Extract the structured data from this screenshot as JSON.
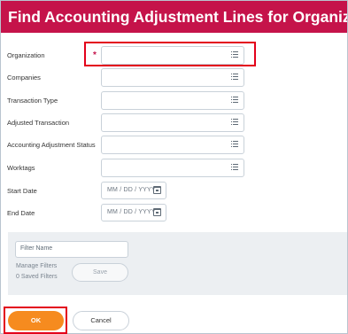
{
  "header": {
    "title": "Find Accounting Adjustment Lines for Organizations"
  },
  "form": {
    "required_marker": "*",
    "fields": [
      {
        "label": "Organization",
        "required": true,
        "icon": "prompt-list-icon"
      },
      {
        "label": "Companies",
        "icon": "prompt-list-icon"
      },
      {
        "label": "Transaction Type",
        "icon": "prompt-list-icon"
      },
      {
        "label": "Adjusted Transaction",
        "icon": "prompt-list-icon"
      },
      {
        "label": "Accounting Adjustment Status",
        "icon": "prompt-list-icon"
      },
      {
        "label": "Worktags",
        "icon": "prompt-list-icon"
      }
    ],
    "start_date": {
      "label": "Start Date",
      "placeholder": "MM / DD / YYYY",
      "icon": "calendar-icon"
    },
    "end_date": {
      "label": "End Date",
      "placeholder": "MM / DD / YYYY",
      "icon": "calendar-icon"
    }
  },
  "filters": {
    "filter_name_placeholder": "Filter Name",
    "manage_filters": "Manage Filters",
    "saved_filters": "0 Saved Filters",
    "save_label": "Save"
  },
  "actions": {
    "ok_label": "OK",
    "cancel_label": "Cancel"
  },
  "colors": {
    "header_bg": "#c5134a",
    "primary_button": "#f68b1f",
    "highlight_box": "#e3001b",
    "required": "#c5134a"
  }
}
